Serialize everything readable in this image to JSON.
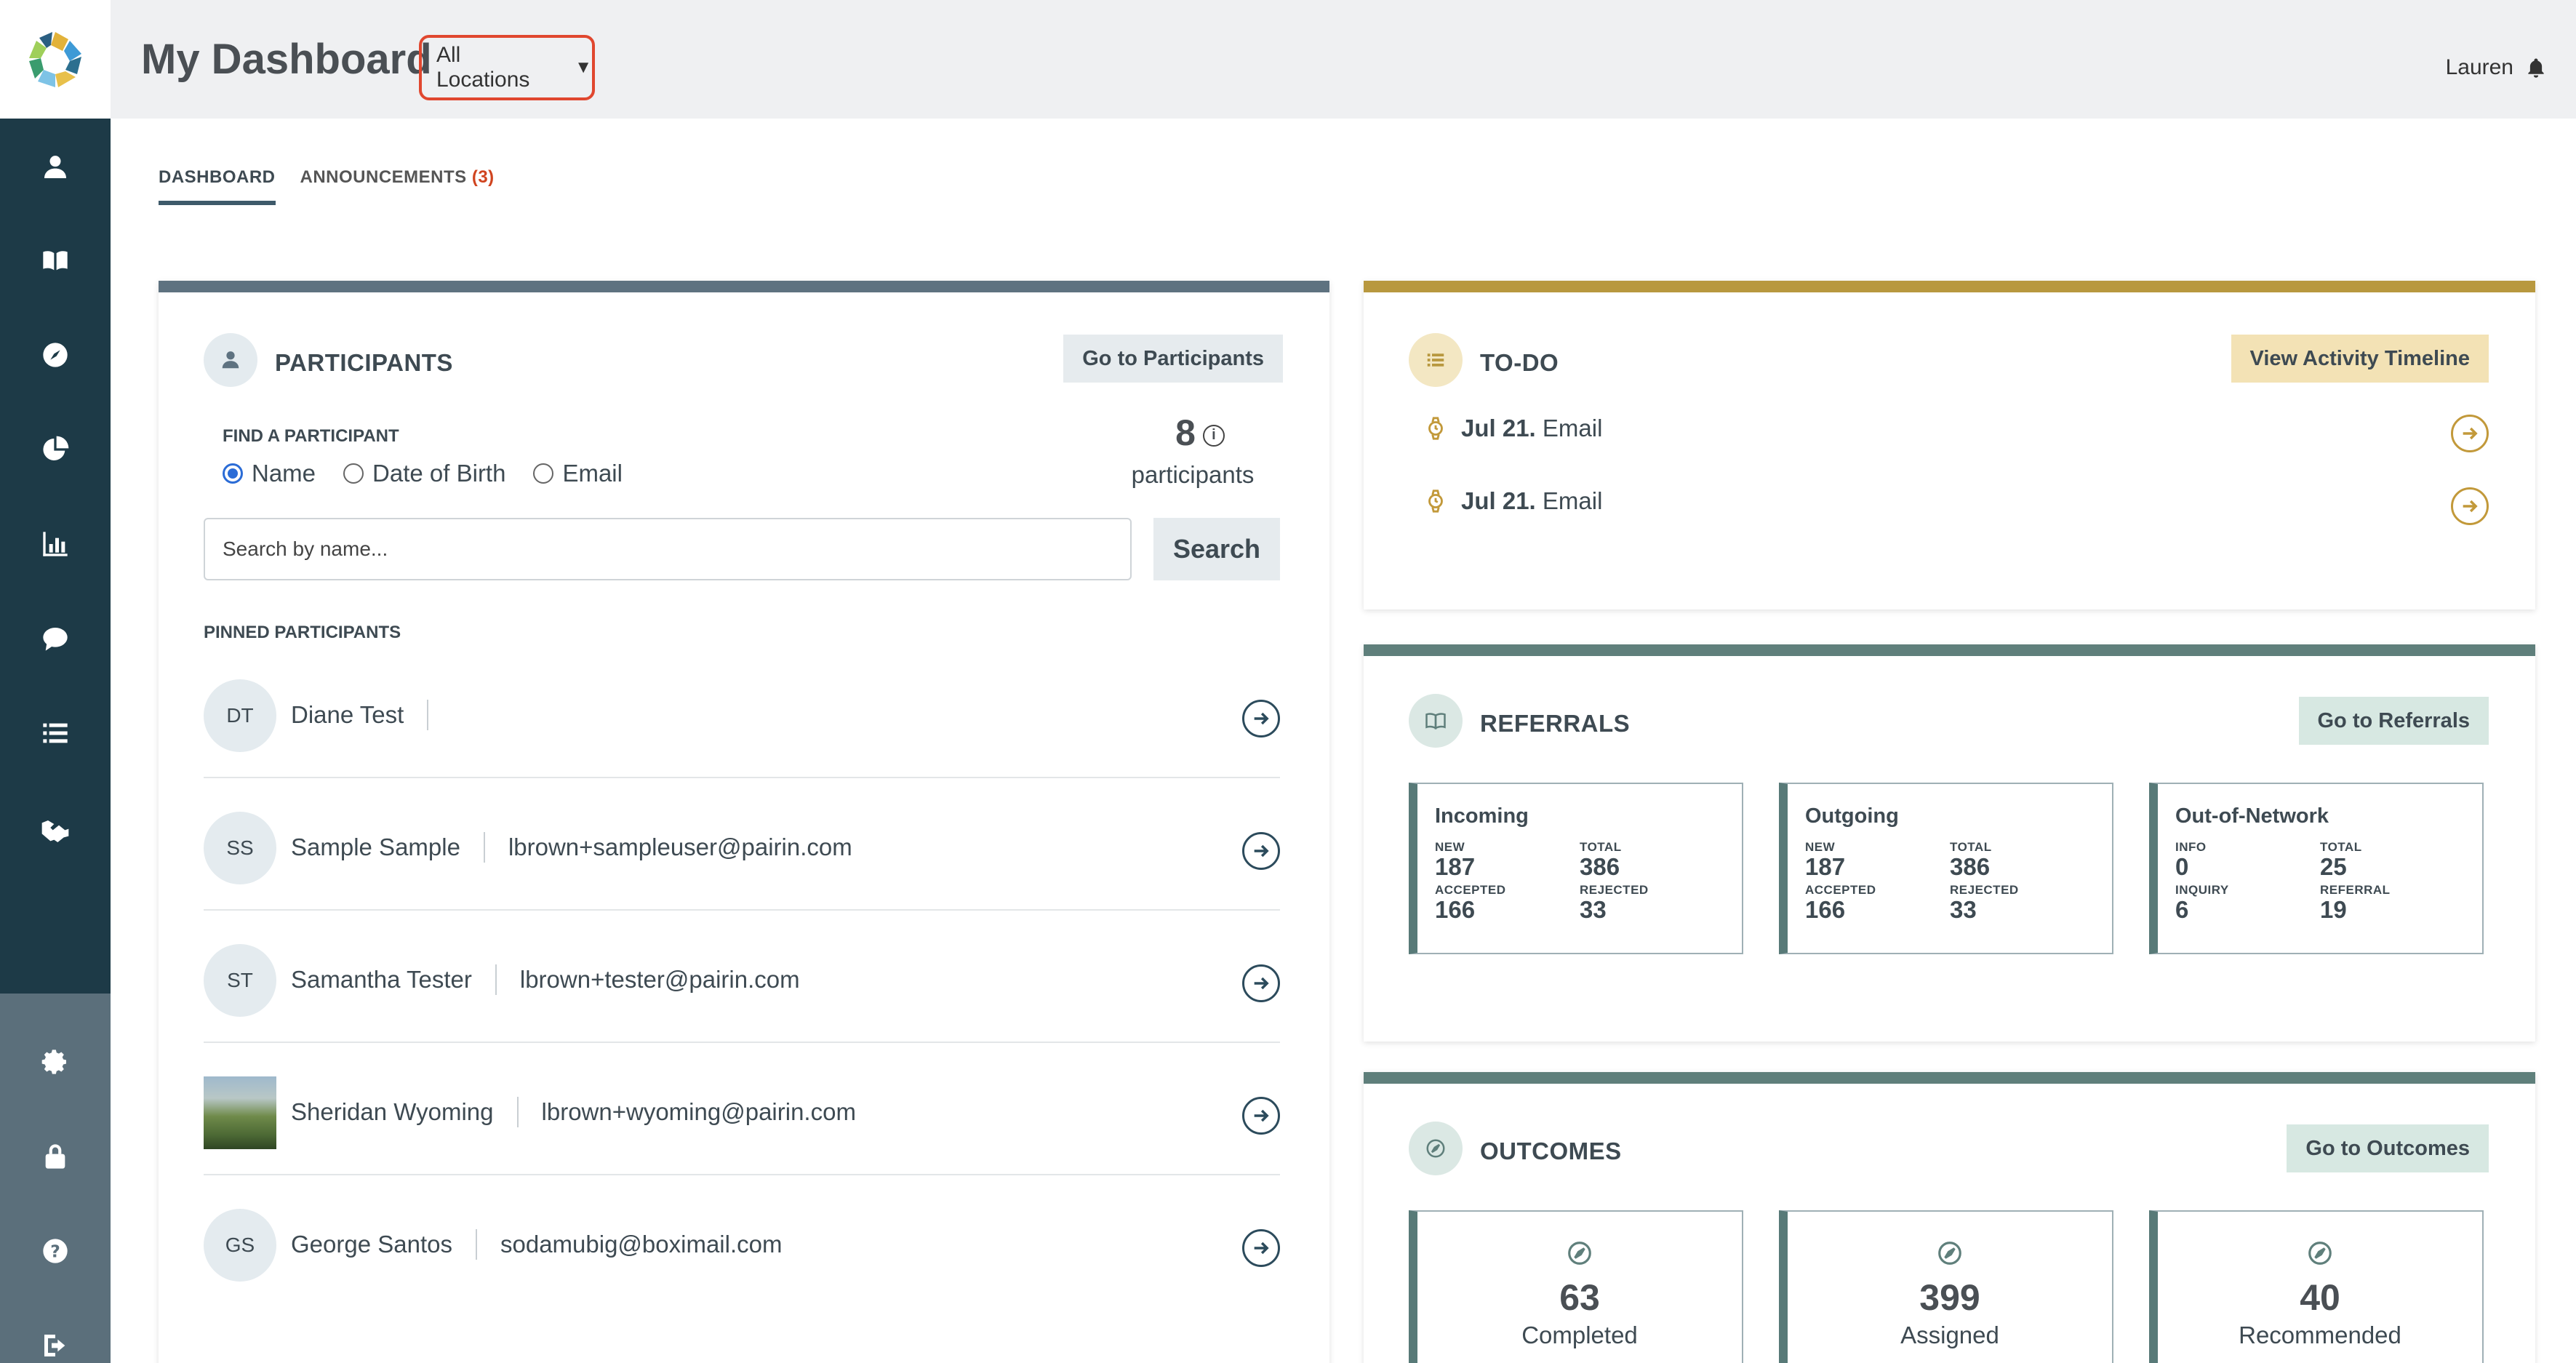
{
  "header": {
    "title": "My Dashboard",
    "location_select": "All Locations",
    "user_name": "Lauren"
  },
  "tabs": [
    {
      "label": "DASHBOARD",
      "active": true
    },
    {
      "label": "ANNOUNCEMENTS",
      "badge": "(3)"
    }
  ],
  "sidebar": {
    "items": [
      "user-icon",
      "book-icon",
      "compass-icon",
      "pie-chart-icon",
      "bar-chart-icon",
      "chat-icon",
      "list-icon",
      "handshake-icon"
    ],
    "bottom_items": [
      "gear-icon",
      "lock-icon",
      "help-icon",
      "logout-icon"
    ]
  },
  "participants": {
    "title": "PARTICIPANTS",
    "button": "Go to Participants",
    "find_label": "FIND A PARTICIPANT",
    "radio_options": [
      "Name",
      "Date of Birth",
      "Email"
    ],
    "count": "8",
    "count_label": "participants",
    "search_placeholder": "Search by name...",
    "search_button": "Search",
    "pinned_label": "PINNED PARTICIPANTS",
    "pinned": [
      {
        "initials": "DT",
        "name": "Diane Test",
        "email": ""
      },
      {
        "initials": "SS",
        "name": "Sample Sample",
        "email": "lbrown+sampleuser@pairin.com"
      },
      {
        "initials": "ST",
        "name": "Samantha Tester",
        "email": "lbrown+tester@pairin.com"
      },
      {
        "initials": "",
        "name": "Sheridan Wyoming",
        "email": "lbrown+wyoming@pairin.com"
      },
      {
        "initials": "GS",
        "name": "George Santos",
        "email": "sodamubig@boximail.com"
      }
    ]
  },
  "todo": {
    "title": "TO-DO",
    "button": "View Activity Timeline",
    "items": [
      {
        "date": "Jul 21.",
        "text": "Email"
      },
      {
        "date": "Jul 21.",
        "text": "Email"
      }
    ]
  },
  "referrals": {
    "title": "REFERRALS",
    "button": "Go to Referrals",
    "boxes": [
      {
        "title": "Incoming",
        "stats": [
          {
            "label": "NEW",
            "value": "187"
          },
          {
            "label": "TOTAL",
            "value": "386"
          },
          {
            "label": "ACCEPTED",
            "value": "166"
          },
          {
            "label": "REJECTED",
            "value": "33"
          }
        ]
      },
      {
        "title": "Outgoing",
        "stats": [
          {
            "label": "NEW",
            "value": "187"
          },
          {
            "label": "TOTAL",
            "value": "386"
          },
          {
            "label": "ACCEPTED",
            "value": "166"
          },
          {
            "label": "REJECTED",
            "value": "33"
          }
        ]
      },
      {
        "title": "Out-of-Network",
        "stats": [
          {
            "label": "INFO",
            "value": "0"
          },
          {
            "label": "TOTAL",
            "value": "25"
          },
          {
            "label": "INQUIRY",
            "value": "6"
          },
          {
            "label": "REFERRAL",
            "value": "19"
          }
        ]
      }
    ]
  },
  "outcomes": {
    "title": "OUTCOMES",
    "button": "Go to Outcomes",
    "boxes": [
      {
        "value": "63",
        "label": "Completed"
      },
      {
        "value": "399",
        "label": "Assigned"
      },
      {
        "value": "40",
        "label": "Recommended"
      }
    ]
  },
  "colors": {
    "sidebar": "#1d3a47",
    "participants_accent": "#5e7280",
    "todo_accent": "#b8983f",
    "referrals_accent": "#5f7f7b",
    "outcomes_accent": "#5f7f7b"
  }
}
